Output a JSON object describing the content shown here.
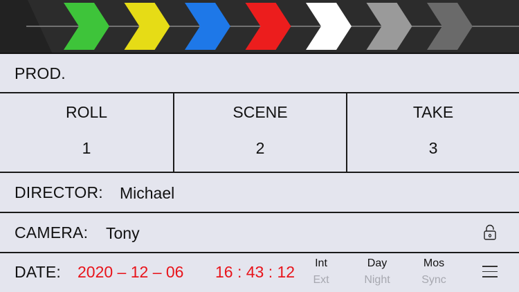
{
  "clapper": {
    "chevron_colors": [
      "#3ec43a",
      "#e6dc16",
      "#1e78e8",
      "#ec1d1d",
      "#ffffff",
      "#9a9a9a",
      "#6a6a6a"
    ],
    "background": "#2c2c2c"
  },
  "prod": {
    "label": "PROD.",
    "value": ""
  },
  "roll": {
    "label": "ROLL",
    "value": "1"
  },
  "scene": {
    "label": "SCENE",
    "value": "2"
  },
  "take": {
    "label": "TAKE",
    "value": "3"
  },
  "director": {
    "label": "DIRECTOR:",
    "value": "Michael"
  },
  "camera": {
    "label": "CAMERA:",
    "value": "Tony",
    "lock_icon": "unlock-icon"
  },
  "date": {
    "label": "DATE:",
    "date_value": "2020 – 12 – 06",
    "time_value": "16 : 43 : 12",
    "value_color": "#e8141b"
  },
  "toggles": [
    {
      "active": "Int",
      "inactive": "Ext"
    },
    {
      "active": "Day",
      "inactive": "Night"
    },
    {
      "active": "Mos",
      "inactive": "Sync"
    }
  ],
  "menu_icon": "menu-icon"
}
